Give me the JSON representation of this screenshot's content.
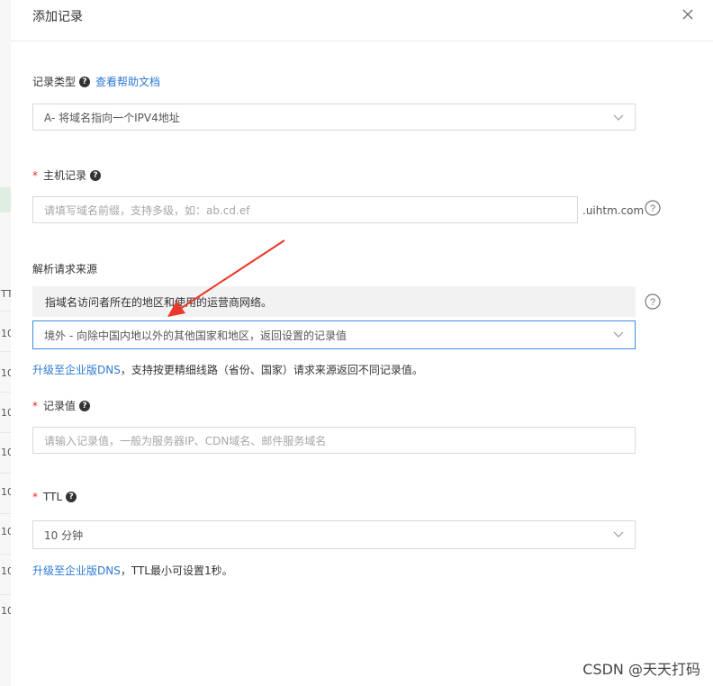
{
  "background": {
    "row_labels": [
      "TT",
      "10",
      "10",
      "10",
      "10",
      "10",
      "10",
      "10",
      "10"
    ]
  },
  "dialog": {
    "title": "添加记录",
    "close_icon": "close-icon",
    "record_type": {
      "label": "记录类型",
      "help_link": "查看帮助文档",
      "value": "A- 将域名指向一个IPV4地址"
    },
    "host_record": {
      "label": "主机记录",
      "placeholder": "请填写域名前缀，支持多级，如：ab.cd.ef",
      "suffix": ".uihtm.com"
    },
    "resolve_source": {
      "label": "解析请求来源",
      "notice": "指域名访问者所在的地区和使用的运营商网络。",
      "value": "境外 - 向除中国内地以外的其他国家和地区，返回设置的记录值",
      "upgrade_link": "升级至企业版DNS",
      "upgrade_text": "，支持按更精细线路（省份、国家）请求来源返回不同记录值。"
    },
    "record_value": {
      "label": "记录值",
      "placeholder": "请输入记录值，一般为服务器IP、CDN域名、邮件服务域名"
    },
    "ttl": {
      "label": "TTL",
      "value": "10 分钟",
      "upgrade_link": "升级至企业版DNS",
      "upgrade_text": "，TTL最小可设置1秒。"
    }
  },
  "watermark": "CSDN @天天打码",
  "colors": {
    "link": "#2c7ad6",
    "required": "#e62b2b",
    "active_border": "#3c8be6",
    "arrow": "#e8392b"
  }
}
